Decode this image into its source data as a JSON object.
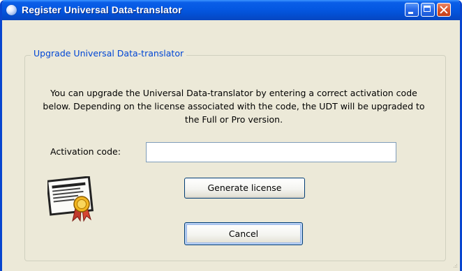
{
  "window": {
    "title": "Register Universal Data-translator",
    "buttons": {
      "minimize": "minimize",
      "maximize": "maximize",
      "close": "close"
    }
  },
  "group": {
    "legend": "Upgrade Universal Data-translator",
    "description": "You can upgrade the Universal Data-translator by entering a correct activation code below. Depending on the license associated with the code, the UDT will be upgraded to the Full or Pro version."
  },
  "form": {
    "activation_label": "Activation code:",
    "activation_value": "",
    "generate_label": "Generate license",
    "cancel_label": "Cancel"
  },
  "icons": {
    "app": "app-globe-icon",
    "certificate": "certificate-icon"
  },
  "colors": {
    "titlebar": "#0458e2",
    "dialog_bg": "#ece9d8",
    "legend_text": "#0046d5",
    "close_button": "#d8542b",
    "button_border": "#003c74"
  }
}
